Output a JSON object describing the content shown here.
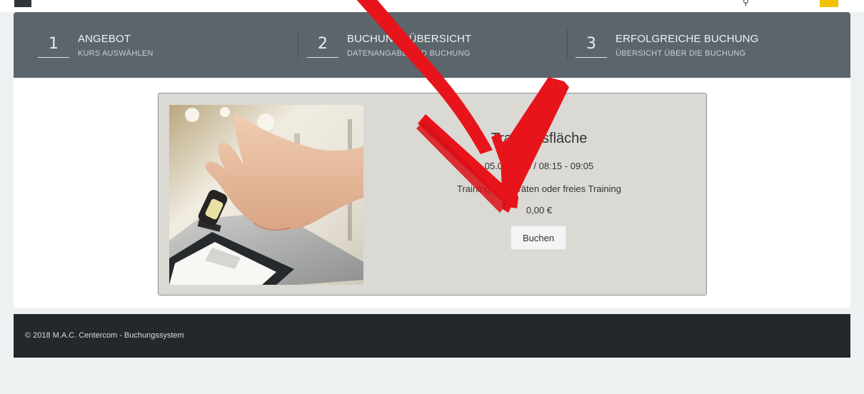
{
  "colors": {
    "steps_bar": "#5b656b",
    "offer_bg": "#dbd9d4",
    "footer_bg": "#23282c",
    "page_bg": "#eef1f2",
    "annotation_arrow": "#e8141b",
    "top_badge": "#f2c200"
  },
  "topbar": {
    "right_icon": "search-icon"
  },
  "steps": [
    {
      "number": "1",
      "title": "ANGEBOT",
      "subtitle": "KURS AUSWÄHLEN"
    },
    {
      "number": "2",
      "title": "BUCHUNGSÜBERSICHT",
      "subtitle": "DATENANGABE UND BUCHUNG"
    },
    {
      "number": "3",
      "title": "ERFOLGREICHE BUCHUNG",
      "subtitle": "ÜBERSICHT ÜBER DIE BUCHUNG"
    }
  ],
  "offer": {
    "title": "Trainingsfläche",
    "datetime": "05.06.2020 / 08:15 - 09:05",
    "description": "Training an Geräten oder freies Training",
    "price": "0,00 €",
    "book_label": "Buchen"
  },
  "footer": {
    "text": "© 2018 M.A.C. Centercom - Buchungssystem"
  }
}
